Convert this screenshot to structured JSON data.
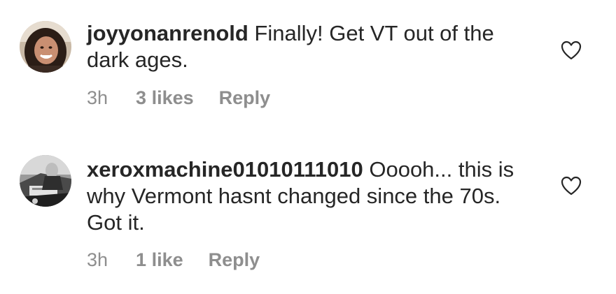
{
  "comments": [
    {
      "username": "joyyonanrenold",
      "text": " Finally! Get VT out of the dark ages.",
      "time": "3h",
      "likes": "3 likes",
      "reply": "Reply",
      "avatar_icon": "profile-photo-smiling-woman",
      "like_icon": "heart-outline-icon"
    },
    {
      "username": "xeroxmachine01010111010",
      "text": " Ooooh... this is why Vermont hasnt changed since the 70s. Got it.",
      "time": "3h",
      "likes": "1 like",
      "reply": "Reply",
      "avatar_icon": "profile-photo-grayscale",
      "like_icon": "heart-outline-icon"
    }
  ],
  "colors": {
    "text": "#262626",
    "secondary": "#8e8e8e",
    "background": "#ffffff"
  }
}
